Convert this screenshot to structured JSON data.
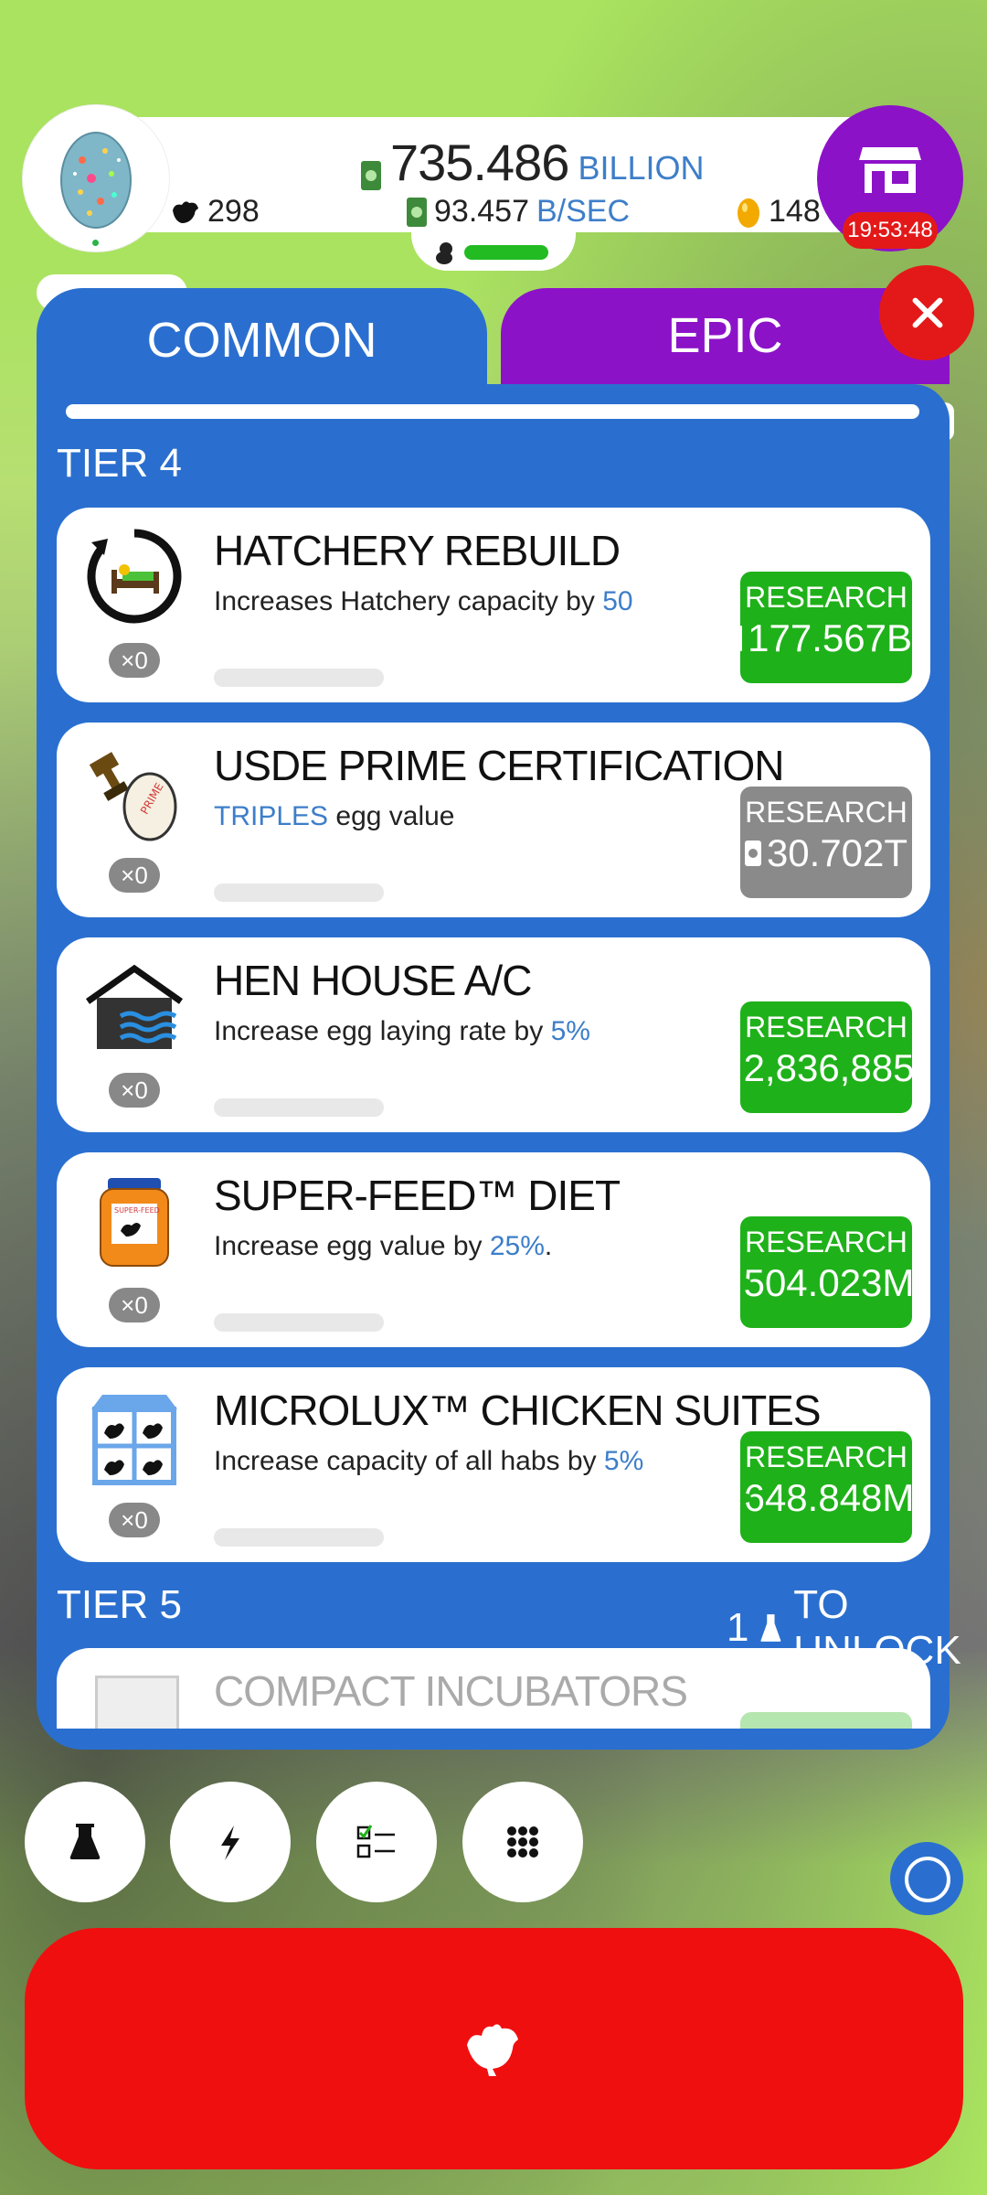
{
  "header": {
    "money": "735.486",
    "money_unit": "BILLION",
    "chickens": "298",
    "rate": "93.457",
    "rate_unit": "B/SEC",
    "golden_eggs": "148",
    "shop_timer": "19:53:48"
  },
  "tabs": {
    "common": "COMMON",
    "epic": "EPIC"
  },
  "tiers": {
    "tier4": "TIER 4",
    "tier5": "TIER 5",
    "tier5_unlock_count": "1",
    "tier5_unlock_text": "TO UNLOCK"
  },
  "research_items": [
    {
      "title": "HATCHERY REBUILD",
      "desc_prefix": "Increases Hatchery capacity by ",
      "desc_highlight": "50",
      "desc_suffix": "",
      "level": "×0",
      "button_label": "RESEARCH",
      "cost": "177.567B",
      "enabled": true
    },
    {
      "title": "USDE PRIME CERTIFICATION",
      "desc_prefix": "",
      "desc_highlight": "TRIPLES",
      "desc_suffix": " egg value",
      "level": "×0",
      "button_label": "RESEARCH",
      "cost": "30.702T",
      "enabled": false
    },
    {
      "title": "HEN HOUSE A/C",
      "desc_prefix": "Increase egg laying rate by ",
      "desc_highlight": "5%",
      "desc_suffix": "",
      "level": "×0",
      "button_label": "RESEARCH",
      "cost": "2,836,885",
      "enabled": true
    },
    {
      "title": "SUPER-FEED™ DIET",
      "desc_prefix": "Increase egg value by ",
      "desc_highlight": "25%",
      "desc_suffix": ".",
      "level": "×0",
      "button_label": "RESEARCH",
      "cost": "504.023M",
      "enabled": true
    },
    {
      "title": "MICROLUX™ CHICKEN SUITES",
      "desc_prefix": "Increase capacity of all habs by ",
      "desc_highlight": "5%",
      "desc_suffix": "",
      "level": "×0",
      "button_label": "RESEARCH",
      "cost": "648.848M",
      "enabled": true
    },
    {
      "title": "COMPACT INCUBATORS",
      "locked": true
    }
  ],
  "icons": {
    "research": "flask-icon",
    "boost": "lightning-icon",
    "missions": "checklist-icon",
    "menu": "grid-icon",
    "hatch": "chicken-icon",
    "shop": "shop-icon",
    "close": "close-icon"
  },
  "colors": {
    "background": "#a9e35f",
    "panel_blue": "#2a6fcf",
    "epic_purple": "#8c12c8",
    "research_green": "#1fb11a",
    "disabled_gray": "#8a8a8a",
    "hatch_red": "#f00f0f",
    "highlight_blue": "#3d7ec9"
  }
}
